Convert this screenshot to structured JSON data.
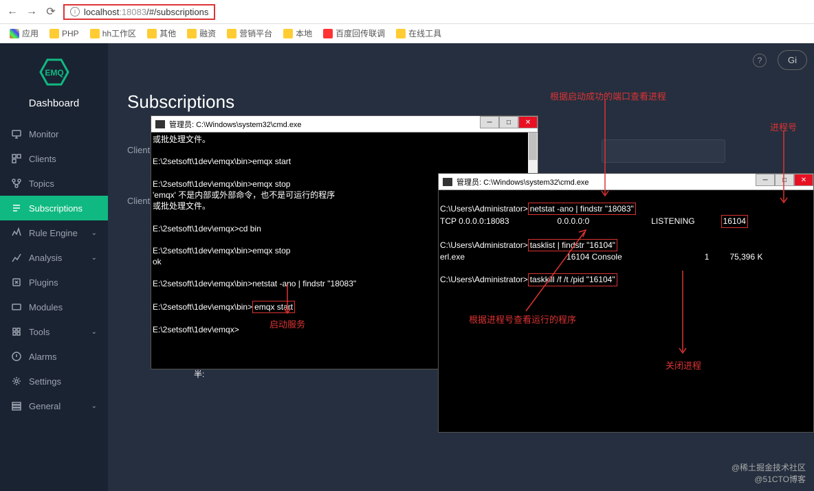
{
  "browser": {
    "url_host": "localhost",
    "url_port": ":18083",
    "url_path": "/#/subscriptions"
  },
  "bookmarks": {
    "apps": "应用",
    "items": [
      "PHP",
      "hh工作区",
      "其他",
      "融资",
      "营销平台",
      "本地",
      "百度回传联调",
      "在线工具"
    ]
  },
  "sidebar": {
    "brand": "Dashboard",
    "items": [
      {
        "label": "Monitor",
        "chev": false
      },
      {
        "label": "Clients",
        "chev": false
      },
      {
        "label": "Topics",
        "chev": false
      },
      {
        "label": "Subscriptions",
        "chev": false,
        "active": true
      },
      {
        "label": "Rule Engine",
        "chev": true
      },
      {
        "label": "Analysis",
        "chev": true
      },
      {
        "label": "Plugins",
        "chev": false
      },
      {
        "label": "Modules",
        "chev": false
      },
      {
        "label": "Tools",
        "chev": true
      },
      {
        "label": "Alarms",
        "chev": false
      },
      {
        "label": "Settings",
        "chev": false
      },
      {
        "label": "General",
        "chev": true
      }
    ]
  },
  "page": {
    "title": "Subscriptions",
    "label1": "Client",
    "label2": "Client",
    "btn_g": "Gi"
  },
  "term1": {
    "title": "管理员: C:\\Windows\\system32\\cmd.exe",
    "l1": "或批处理文件。",
    "l2": "E:\\2setsoft\\1dev\\emqx\\bin>emqx start",
    "l3": "E:\\2setsoft\\1dev\\emqx\\bin>emqx stop",
    "l4": "'emqx' 不是内部或外部命令，也不是可运行的程序",
    "l5": "或批处理文件。",
    "l6": "E:\\2setsoft\\1dev\\emqx>cd bin",
    "l7": "E:\\2setsoft\\1dev\\emqx\\bin>emqx stop",
    "l8": "ok",
    "l9": "E:\\2setsoft\\1dev\\emqx\\bin>netstat -ano | findstr \"18083\"",
    "l10a": "E:\\2setsoft\\1dev\\emqx\\bin>",
    "l10b": "emqx start",
    "l11": "E:\\2setsoft\\1dev\\emqx>",
    "l12": "半:"
  },
  "term2": {
    "title": "管理员: C:\\Windows\\system32\\cmd.exe",
    "p1a": "C:\\Users\\Administrator>",
    "p1b": "netstat -ano | findstr \"18083\"",
    "r1a": "  TCP    0.0.0.0:18083",
    "r1b": "0.0.0.0:0",
    "r1c": "LISTENING",
    "r1d": "16104",
    "p2a": "C:\\Users\\Administrator>",
    "p2b": "tasklist | findstr \"16104\"",
    "r2a": "erl.exe",
    "r2b": "16104 Console",
    "r2c": "1",
    "r2d": "75,396 K",
    "p3a": "C:\\Users\\Administrator>",
    "p3b": "taskkill /f /t /pid \"16104\""
  },
  "anno": {
    "a1": "根据启动成功的端口查看进程",
    "a2": "进程号",
    "a3": "启动服务",
    "a4": "根据进程号查看运行的程序",
    "a5": "关闭进程"
  },
  "watermark": {
    "l1": "@稀土掘金技术社区",
    "l2": "@51CTO博客"
  }
}
